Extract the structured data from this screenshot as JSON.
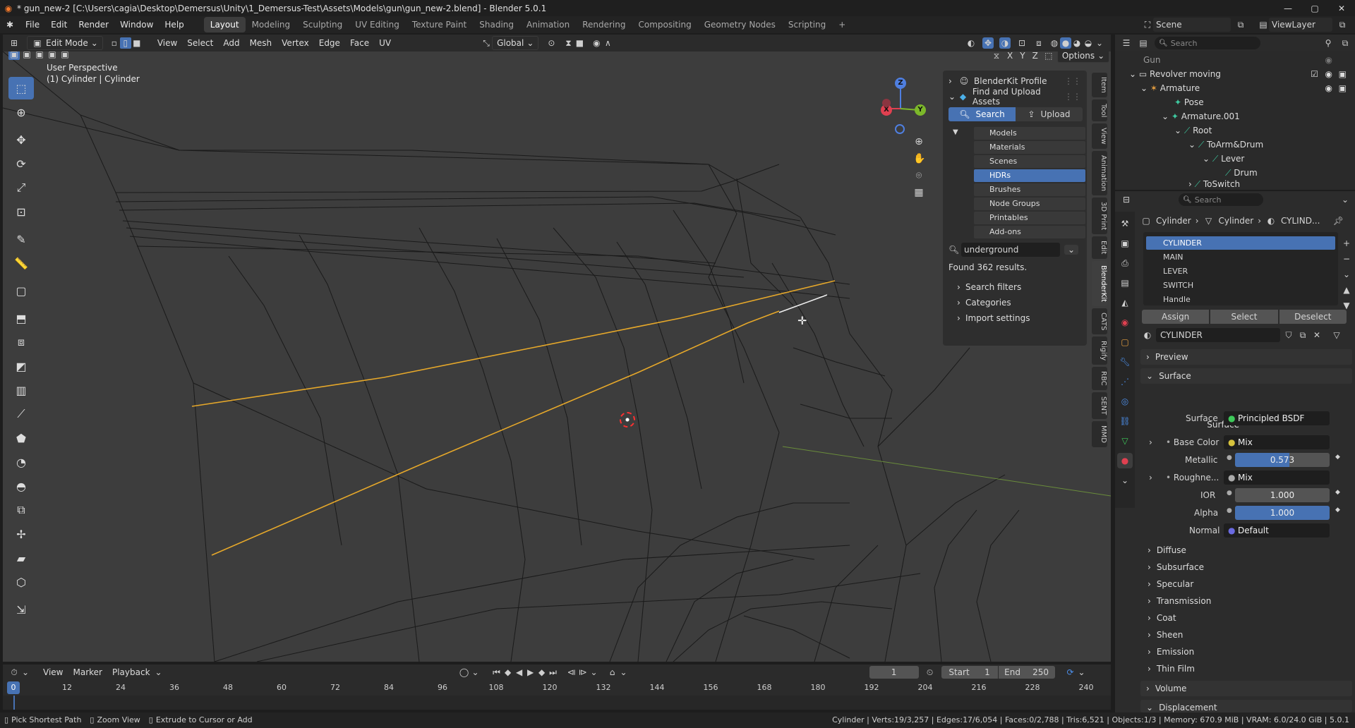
{
  "titlebar": {
    "title": "* gun_new-2 [C:\\Users\\cagia\\Desktop\\Demersus\\Unity\\1_Demersus-Test\\Assets\\Models\\gun\\gun_new-2.blend] - Blender 5.0.1",
    "minimize": "—",
    "maximize": "▢",
    "close": "✕"
  },
  "menu": [
    "File",
    "Edit",
    "Render",
    "Window",
    "Help"
  ],
  "workspaces": [
    "Layout",
    "Modeling",
    "Sculpting",
    "UV Editing",
    "Texture Paint",
    "Shading",
    "Animation",
    "Rendering",
    "Compositing",
    "Geometry Nodes",
    "Scripting"
  ],
  "workspace_add": "+",
  "scene": {
    "label": "Scene",
    "viewlayer": "ViewLayer"
  },
  "viewport_header": {
    "mode": "Edit Mode",
    "menus": [
      "View",
      "Select",
      "Add",
      "Mesh",
      "Vertex",
      "Edge",
      "Face",
      "UV"
    ],
    "transform": "Global",
    "options": "Options",
    "axes": [
      "X",
      "Y",
      "Z"
    ]
  },
  "viewport": {
    "perspective": "User Perspective",
    "object": "(1) Cylinder | Cylinder"
  },
  "gizmo": {
    "z": "Z",
    "y": "Y",
    "x": "X"
  },
  "npanel": {
    "profile": "BlenderKit Profile",
    "find_upload": "Find and Upload Assets",
    "search_btn": "Search",
    "upload_btn": "Upload",
    "categories": [
      "Models",
      "Materials",
      "Scenes",
      "HDRs",
      "Brushes",
      "Node Groups",
      "Printables",
      "Add-ons"
    ],
    "selected_category": "HDRs",
    "search_value": "underground",
    "results": "Found 362 results.",
    "search_filters": "Search filters",
    "categories_label": "Categories",
    "import_settings": "Import settings"
  },
  "vtabs": [
    "Item",
    "Tool",
    "View",
    "Animation",
    "3D Print",
    "Edit",
    "BlenderKit",
    "CATS",
    "Rigify",
    "RBC",
    "SENT",
    "MMD"
  ],
  "outliner": {
    "search_placeholder": "Search",
    "rows": [
      "Gun",
      "Revolver moving",
      "Armature",
      "Pose",
      "Armature.001",
      "Root",
      "ToArm&Drum",
      "Lever",
      "Drum",
      "ToSwitch"
    ]
  },
  "properties": {
    "search_placeholder": "Search",
    "breadcrumb": [
      "Cylinder",
      "Cylinder",
      "CYLIND..."
    ],
    "material_slots": [
      "CYLINDER",
      "MAIN",
      "LEVER",
      "SWITCH",
      "Handle"
    ],
    "assign": "Assign",
    "select": "Select",
    "deselect": "Deselect",
    "material_name": "CYLINDER",
    "preview": "Preview",
    "surface_section": "Surface",
    "surface_label": "Surface",
    "surface_value": "Principled BSDF",
    "base_color_label": "Base Color",
    "base_color_value": "Mix",
    "metallic_label": "Metallic",
    "metallic_value": "0.573",
    "roughness_label": "Roughne...",
    "roughness_value": "Mix",
    "ior_label": "IOR",
    "ior_value": "1.000",
    "alpha_label": "Alpha",
    "alpha_value": "1.000",
    "normal_label": "Normal",
    "normal_value": "Default",
    "subsections": [
      "Diffuse",
      "Subsurface",
      "Specular",
      "Transmission",
      "Coat",
      "Sheen",
      "Emission",
      "Thin Film"
    ],
    "volume": "Volume",
    "displacement": "Displacement"
  },
  "timeline": {
    "menus": [
      "View",
      "Marker",
      "Playback"
    ],
    "current_frame": "1",
    "start_label": "Start",
    "start_value": "1",
    "end_label": "End",
    "end_value": "250",
    "ticks": [
      "0",
      "12",
      "24",
      "36",
      "48",
      "60",
      "72",
      "84",
      "96",
      "108",
      "120",
      "132",
      "144",
      "156",
      "168",
      "180",
      "192",
      "204",
      "216",
      "228",
      "240"
    ]
  },
  "statusbar": {
    "hints": [
      "Pick Shortest Path",
      "Zoom View",
      "Extrude to Cursor or Add"
    ],
    "stats": "Cylinder | Verts:19/3,257 | Edges:17/6,054 | Faces:0/2,788 | Tris:6,521 | Objects:1/3 | Memory: 670.9 MiB | VRAM: 6.0/24.0 GiB | 5.0.1"
  },
  "colors": {
    "accent": "#4772b3",
    "selected_edge": "#e6a82a",
    "background": "#3d3d3d"
  }
}
